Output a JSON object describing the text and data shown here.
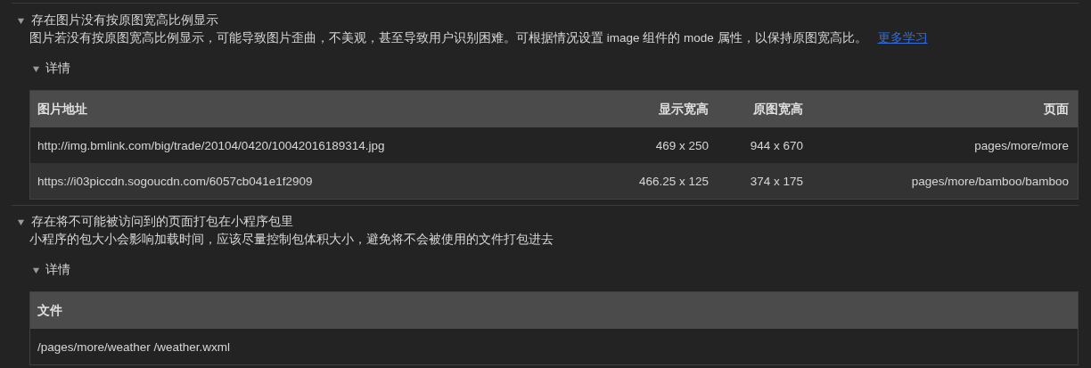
{
  "issues": [
    {
      "title": "存在图片没有按原图宽高比例显示",
      "expanded": true,
      "description": "图片若没有按原图宽高比例显示，可能导致图片歪曲，不美观，甚至导致用户识别困难。可根据情况设置 image 组件的 mode 属性，以保持原图宽高比。",
      "link": "更多学习",
      "details": {
        "label": "详情",
        "expanded": true,
        "table": {
          "columns": [
            "图片地址",
            "显示宽高",
            "原图宽高",
            "页面"
          ],
          "rows": [
            [
              "http://img.bmlink.com/big/trade/20104/0420/10042016189314.jpg",
              "469 x 250",
              "944 x 670",
              "pages/more/more"
            ],
            [
              "https://i03piccdn.sogoucdn.com/6057cb041e1f2909",
              "466.25 x 125",
              "374 x 175",
              "pages/more/bamboo/bamboo"
            ]
          ]
        }
      }
    },
    {
      "title": "存在将不可能被访问到的页面打包在小程序包里",
      "expanded": true,
      "description": "小程序的包大小会影响加载时间，应该尽量控制包体积大小，避免将不会被使用的文件打包进去",
      "details": {
        "label": "详情",
        "expanded": true,
        "table": {
          "columns": [
            "文件"
          ],
          "rows": [
            [
              "/pages/more/weather /weather.wxml"
            ]
          ]
        }
      }
    }
  ]
}
